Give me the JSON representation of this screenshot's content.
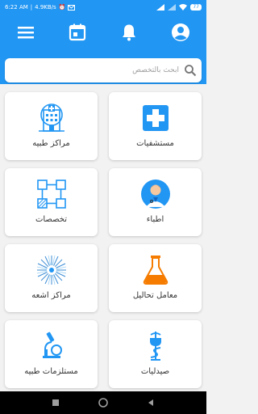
{
  "status_bar": {
    "time": "6:22 AM",
    "speed": "4.9KB/s",
    "battery": "77"
  },
  "app_bar": {
    "menu_icon": "menu-icon",
    "calendar_icon": "calendar-icon",
    "notifications_icon": "bell-icon",
    "profile_icon": "account-circle-icon"
  },
  "search": {
    "placeholder": "ابحث بالتخصص",
    "value": ""
  },
  "cards": [
    {
      "label": "مستشفيات",
      "icon": "hospital-cross-icon"
    },
    {
      "label": "مراكز طبيه",
      "icon": "medical-center-building-icon"
    },
    {
      "label": "اطباء",
      "icon": "doctor-icon"
    },
    {
      "label": "تخصصات",
      "icon": "specialties-network-icon"
    },
    {
      "label": "معامل تحاليل",
      "icon": "lab-flask-icon"
    },
    {
      "label": "مراكز اشعه",
      "icon": "radiology-burst-icon"
    },
    {
      "label": "صيدليات",
      "icon": "pharmacy-caduceus-icon"
    },
    {
      "label": "مستلزمات طبيه",
      "icon": "microscope-icon"
    }
  ],
  "colors": {
    "primary": "#2196f3",
    "accent_orange": "#f57c00",
    "card_bg": "#ffffff",
    "page_bg": "#f2f2f2"
  }
}
